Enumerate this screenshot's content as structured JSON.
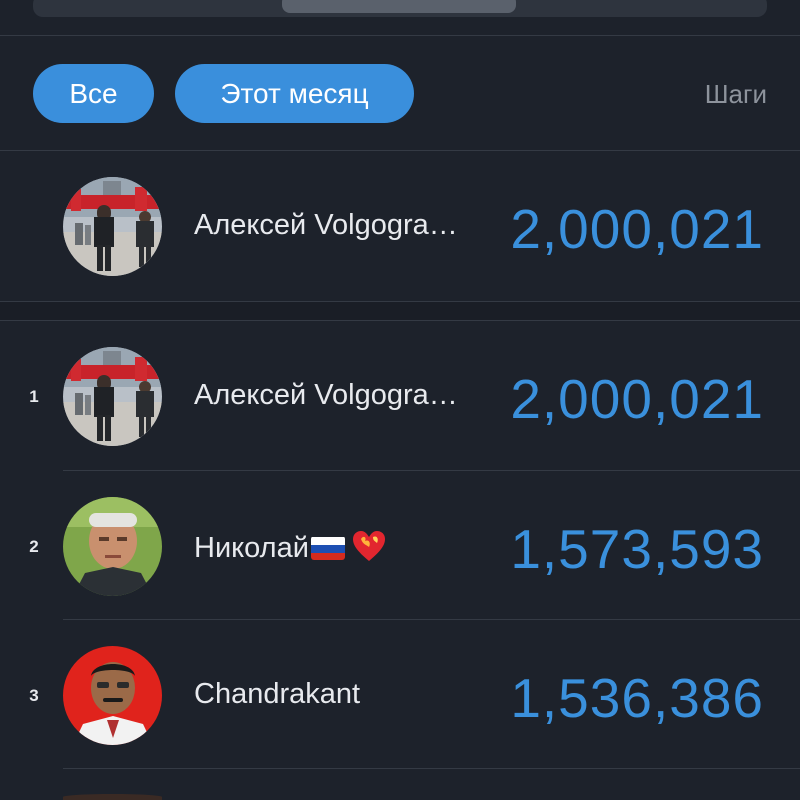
{
  "filters": {
    "all_label": "Все",
    "month_label": "Этот месяц",
    "metric_label": "Шаги"
  },
  "current_user": {
    "name": "Алексей Volgogra…",
    "steps": "2,000,021"
  },
  "leaderboard": [
    {
      "rank": "1",
      "name": "Алексей Volgogra…",
      "steps": "2,000,021",
      "avatar": "street-photo-avatar"
    },
    {
      "rank": "2",
      "name": "Николай",
      "emoji": [
        "russia-flag-icon",
        "burning-heart-icon"
      ],
      "steps": "1,573,593",
      "avatar": "man-outdoor-avatar"
    },
    {
      "rank": "3",
      "name": "Chandrakant",
      "steps": "1,536,386",
      "avatar": "man-red-background-avatar"
    }
  ],
  "colors": {
    "background": "#1d222b",
    "accent": "#3a8fdc",
    "text": "#e8eaee",
    "muted": "#8d939c"
  }
}
